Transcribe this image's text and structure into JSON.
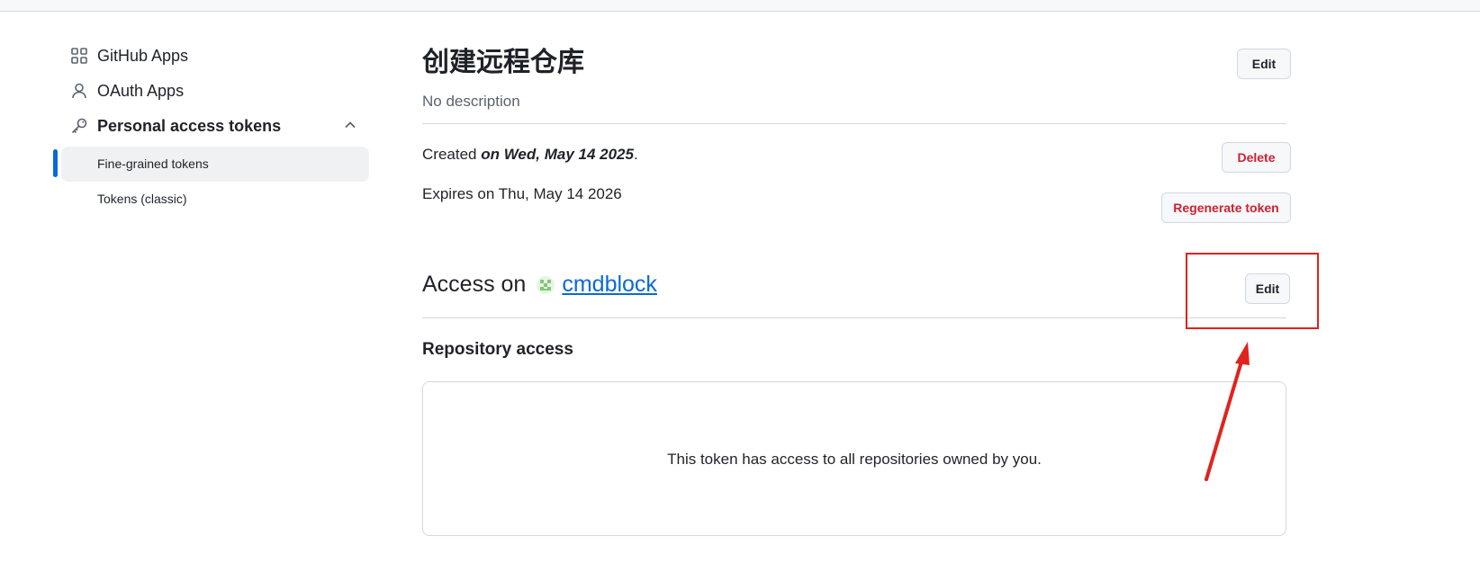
{
  "sidebar": {
    "items": [
      {
        "label": "GitHub Apps",
        "icon": "apps-grid-icon"
      },
      {
        "label": "OAuth Apps",
        "icon": "person-icon"
      },
      {
        "label": "Personal access tokens",
        "icon": "key-icon"
      }
    ],
    "sub_items": [
      {
        "label": "Fine-grained tokens",
        "active": true
      },
      {
        "label": "Tokens (classic)",
        "active": false
      }
    ]
  },
  "token": {
    "name": "创建远程仓库",
    "description": "No description",
    "created_prefix": "Created ",
    "created_date": "on Wed, May 14 2025",
    "created_suffix": ".",
    "expires": "Expires on Thu, May 14 2026"
  },
  "buttons": {
    "edit_top": "Edit",
    "delete": "Delete",
    "regenerate": "Regenerate token",
    "edit_access": "Edit"
  },
  "access": {
    "prefix": "Access on",
    "owner": "cmdblock"
  },
  "repository": {
    "heading": "Repository access",
    "message": "This token has access to all repositories owned by you."
  },
  "colors": {
    "accent": "#0969da",
    "danger": "#cf222e",
    "annotation": "#e0231c"
  }
}
